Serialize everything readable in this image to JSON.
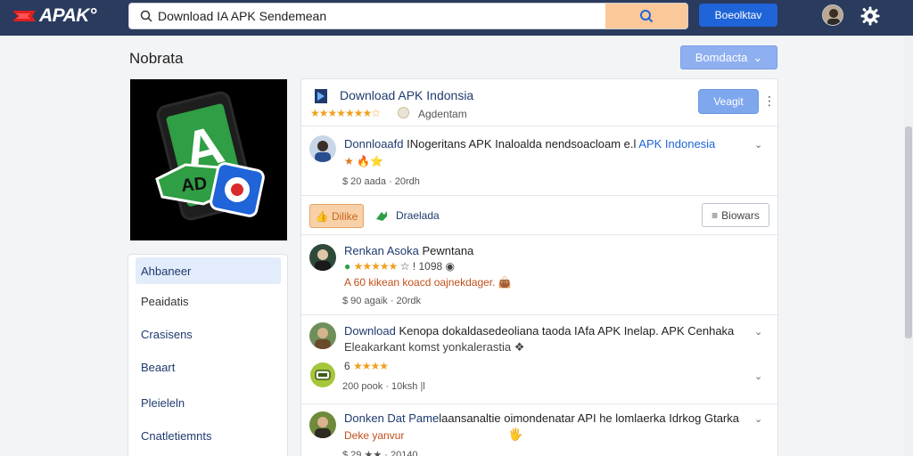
{
  "header": {
    "logo_text": "APAK°",
    "search_value": "Download IA APK Sendemean",
    "primary_button": "Boeolktav"
  },
  "page": {
    "title": "Nobrata",
    "top_right_button": "Bomdacta"
  },
  "nav": {
    "items": [
      {
        "label": "Ahbaneer"
      },
      {
        "label": "Peaidatis"
      },
      {
        "label": "Crasisens"
      },
      {
        "label": "Beaart"
      },
      {
        "label": "Pleieleln"
      },
      {
        "label": "Cnatletiemnts"
      }
    ]
  },
  "app": {
    "name": "Download APK Indonsia",
    "stars": "★★★★★★★☆",
    "tag": "Agdentam",
    "install_button": "Veagit"
  },
  "posts": [
    {
      "title_highlight": "Donnloaafd",
      "title_text": " INogeritans APK Inaloalda nendsoacloam e.l",
      "title_link": " APK Indonesia",
      "sub": "★ 🔥⭐",
      "meta": "$ 20 aada · 20rdh"
    },
    {
      "title_highlight": "Renkan Asoka",
      "title_text": " Pewntana",
      "stars": "★★★★★",
      "sub": "☆ ! 1098 ◉",
      "sub2": "A 60 kikean koacd oajnekdager.",
      "meta": "$ 90 agaik · 20rdk"
    },
    {
      "title_highlight": "Download",
      "title_text": " Kenopa dokaldasedeoliana taoda IAfa APK Inelap. APK Cenhaka",
      "line2": "Eleakarkant komst yonkalerastia",
      "stars": "★★★★",
      "stars_prefix": "6",
      "meta": "200 pook · 10ksh |l"
    },
    {
      "title_highlight": "Donken Dat Pame",
      "title_text": "laansanaltie oimondenatar API he lomlaerka Idrkog Gtarka",
      "line2": "Deke yanvur",
      "meta": "$ 29 ★★ · 20140"
    }
  ],
  "actions": {
    "like": "👍 Dilike",
    "share": "Draelada",
    "browse": "Biowars"
  }
}
